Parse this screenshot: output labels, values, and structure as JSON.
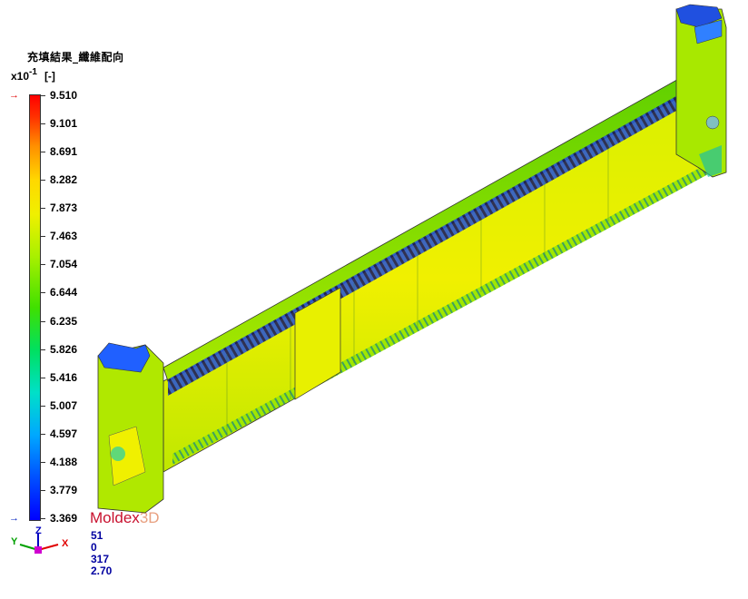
{
  "title": "充填結果_纖維配向",
  "unit": {
    "base": "x10",
    "exponent": "-1",
    "bracket": "[-]"
  },
  "scale": {
    "ticks": [
      "9.510",
      "9.101",
      "8.691",
      "8.282",
      "7.873",
      "7.463",
      "7.054",
      "6.644",
      "6.235",
      "5.826",
      "5.416",
      "5.007",
      "4.597",
      "4.188",
      "3.779",
      "3.369"
    ],
    "max": 9.51,
    "min": 3.369
  },
  "brand": {
    "part1": "Moldex",
    "part2": "3D"
  },
  "axes": {
    "x": "X",
    "y": "Y",
    "z": "Z"
  },
  "info": [
    "51",
    "0",
    "317",
    "2.70"
  ],
  "colors": {
    "bar_top": "#ff0000",
    "bar_bottom": "#0000ff",
    "info_text": "#0000a0",
    "brand": "#c8102e"
  }
}
